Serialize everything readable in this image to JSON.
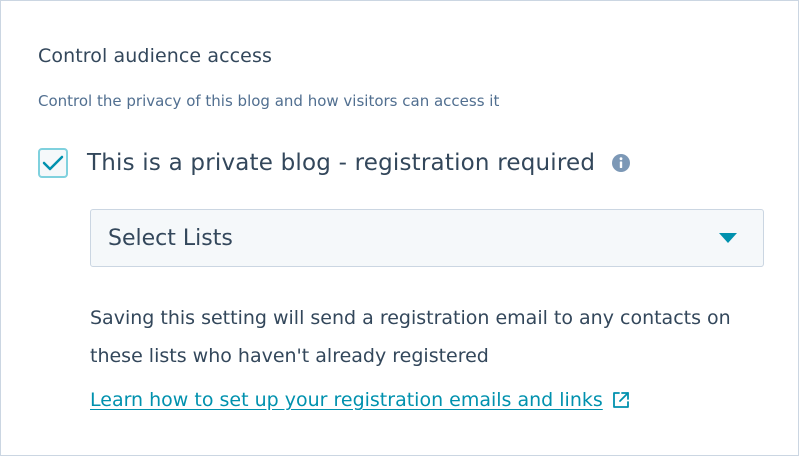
{
  "section": {
    "title": "Control audience access",
    "subtitle": "Control the privacy of this blog and how visitors can access it"
  },
  "private_blog": {
    "checked": true,
    "label": "This is a private blog - registration required",
    "info_icon": "info-icon"
  },
  "lists_select": {
    "value": "Select Lists",
    "caret_icon": "caret-down-icon"
  },
  "help_text": "Saving this setting will send a registration email to any contacts on these lists who haven't already registered",
  "learn_link": {
    "label": "Learn how to set up your registration emails and links",
    "icon": "external-link-icon"
  },
  "colors": {
    "text": "#33475b",
    "subtext": "#516f90",
    "link": "#0091ae",
    "checkbox_border": "#7fd1de",
    "check_mark": "#0091ae",
    "border": "#cbd6e2",
    "field_bg": "#f5f8fa"
  }
}
